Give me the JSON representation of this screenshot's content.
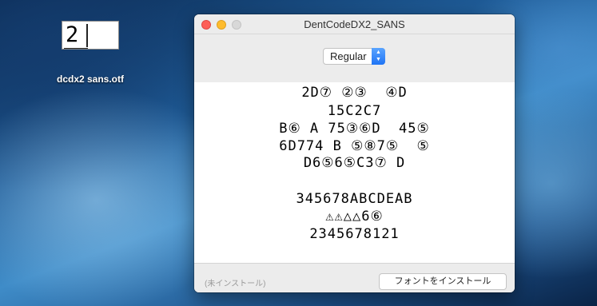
{
  "desktop": {
    "file_icon_glyph": "2",
    "file_name": "dcdx2 sans.otf"
  },
  "window": {
    "title": "DentCodeDX2_SANS",
    "style_select": {
      "selected": "Regular"
    },
    "preview_lines": [
      "2D⑦ ②③  ④D",
      "15C2C7",
      "B⑥ A 75③⑥D  45⑤",
      "6D774 B ⑤⑧7⑤  ⑤",
      "D6⑤6⑤C3⑦ D",
      "",
      "345678ABCDEAB",
      "⚠⚠△△6⑥",
      "2345678121"
    ],
    "status_text": "(未インストール)",
    "install_button_label": "フォントをインストール"
  }
}
